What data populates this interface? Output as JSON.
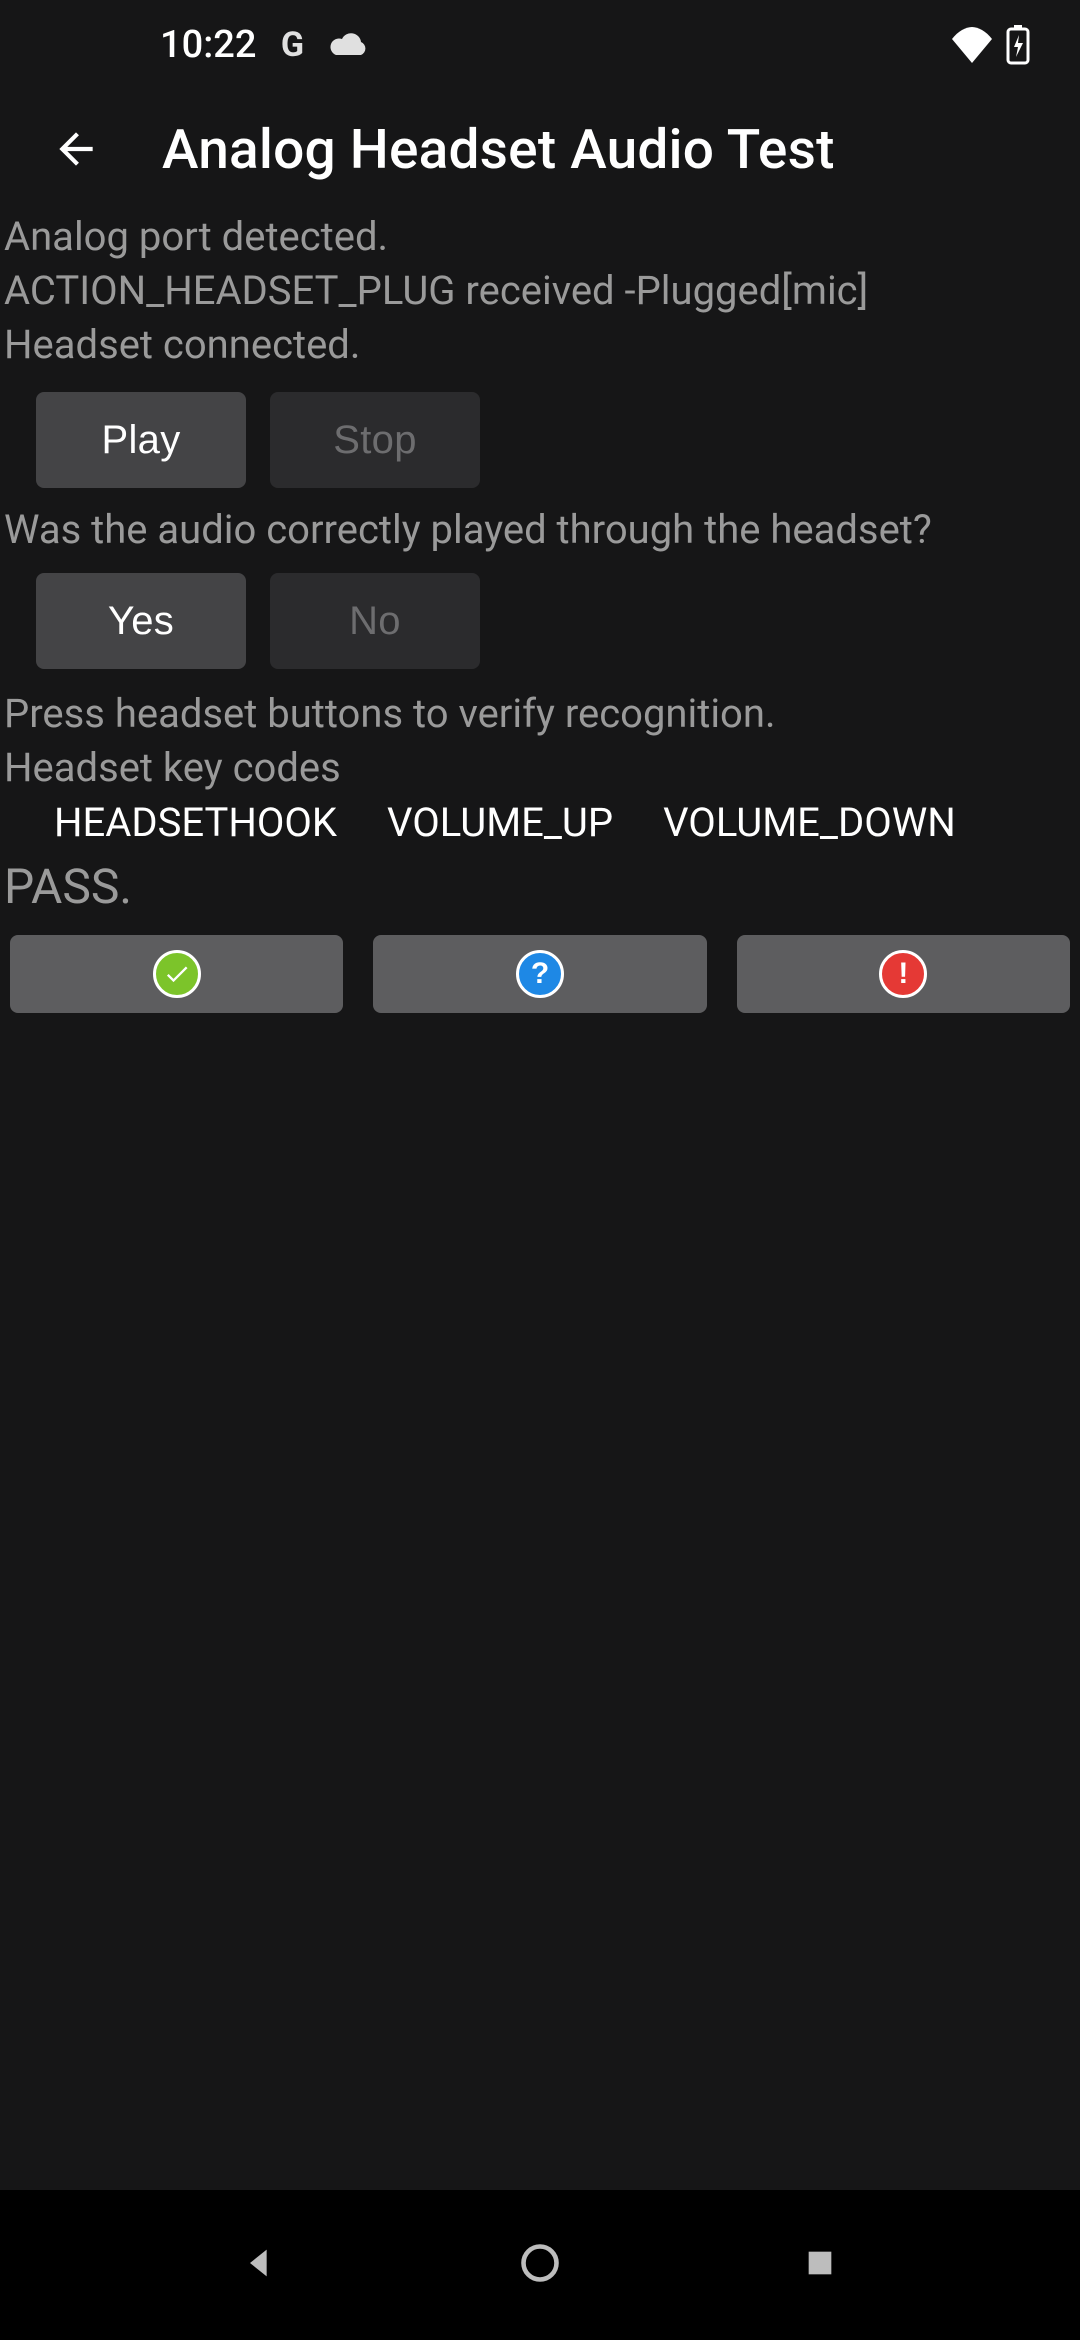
{
  "status_bar": {
    "time": "10:22"
  },
  "app_bar": {
    "title": "Analog Headset Audio Test"
  },
  "detection": {
    "line1": "Analog port detected.",
    "line2": "ACTION_HEADSET_PLUG received -Plugged[mic]",
    "line3": "Headset connected."
  },
  "play_controls": {
    "play_label": "Play",
    "stop_label": "Stop"
  },
  "question": "Was the audio correctly played through the headset?",
  "answer_buttons": {
    "yes_label": "Yes",
    "no_label": "No"
  },
  "instructions": {
    "line1": "Press headset buttons to verify recognition.",
    "line2": "Headset key codes"
  },
  "key_codes": [
    "HEADSETHOOK",
    "VOLUME_UP",
    "VOLUME_DOWN"
  ],
  "result": "PASS."
}
